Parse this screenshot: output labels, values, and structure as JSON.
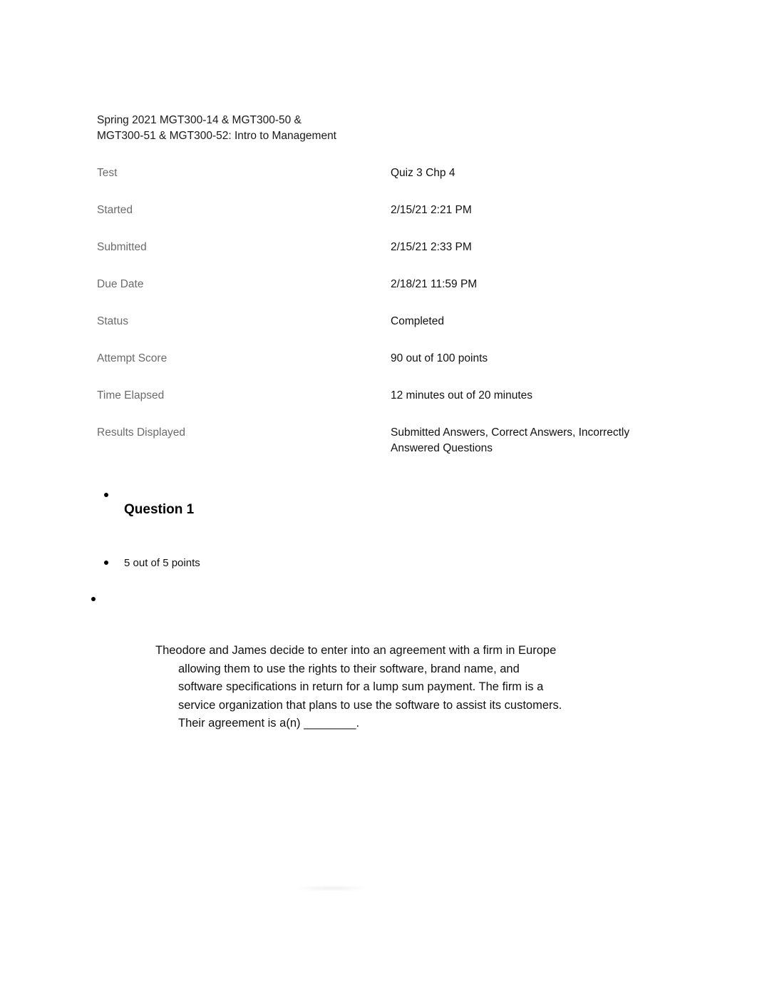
{
  "document": {
    "course_title": "Spring 2021 MGT300-14 & MGT300-50 &\nMGT300-51 & MGT300-52: Intro to Management"
  },
  "attempt_details": {
    "rows": [
      {
        "label": "Test",
        "value": "Quiz 3 Chp 4"
      },
      {
        "label": "Started",
        "value": "2/15/21 2:21 PM"
      },
      {
        "label": "Submitted",
        "value": "2/15/21 2:33 PM"
      },
      {
        "label": "Due Date",
        "value": "2/18/21 11:59 PM"
      },
      {
        "label": "Status",
        "value": "Completed"
      },
      {
        "label": "Attempt Score",
        "value": "90 out of 100 points"
      },
      {
        "label": "Time Elapsed",
        "value": "12 minutes out of 20 minutes"
      },
      {
        "label": "Results Displayed",
        "value": "Submitted Answers, Correct Answers, Incorrectly Answered Questions"
      }
    ]
  },
  "question": {
    "heading": "Question 1",
    "points": "5 out of 5 points",
    "body": "Theodore and James decide to enter into an agreement with a firm in Europe allowing them to use the rights to their software, brand name, and software specifications in return for a lump sum payment. The firm is a service organization that plans to use the software to assist its customers. Their agreement is a(n) ________."
  },
  "colors": {
    "label_gray": "#6b6b6b",
    "body_text": "#111111",
    "page_background": "#ffffff"
  }
}
